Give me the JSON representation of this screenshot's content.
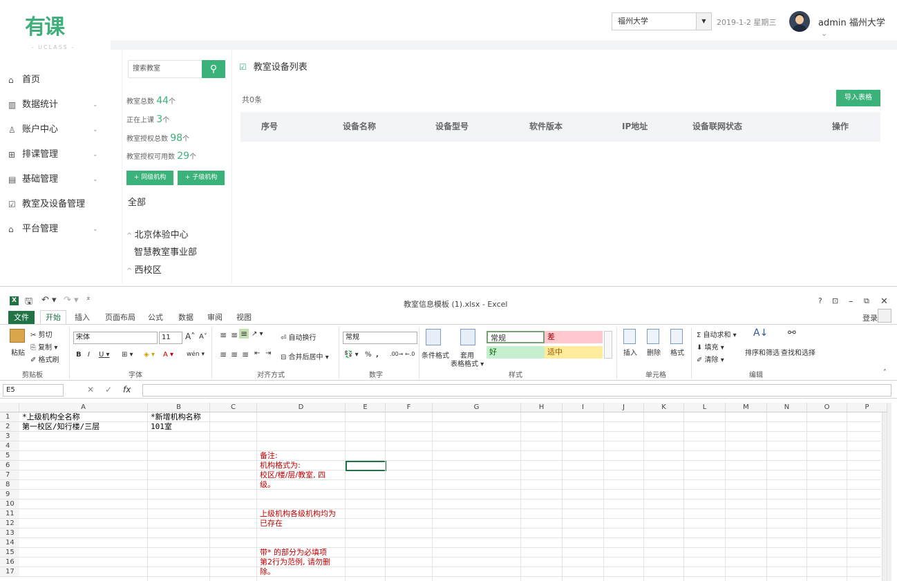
{
  "web": {
    "logo": {
      "mark": "有课",
      "sub": "- UCLASS -"
    },
    "header": {
      "school_select": "福州大学",
      "date": "2019-1-2 星期三",
      "user": "admin 福州大学",
      "user_caret": "⌄"
    },
    "nav": [
      {
        "icon": "⌂",
        "label": "首页",
        "has_chevron": false
      },
      {
        "icon": "▥",
        "label": "数据统计",
        "has_chevron": true
      },
      {
        "icon": "♙",
        "label": "账户中心",
        "has_chevron": true
      },
      {
        "icon": "⊞",
        "label": "排课管理",
        "has_chevron": true
      },
      {
        "icon": "▤",
        "label": "基础管理",
        "has_chevron": true
      },
      {
        "icon": "☑",
        "label": "教室及设备管理",
        "has_chevron": false
      },
      {
        "icon": "⌂",
        "label": "平台管理",
        "has_chevron": true
      }
    ],
    "chevron": "⌄",
    "left_panel": {
      "search_placeholder": "搜索教室",
      "search_icon": "⚲",
      "stats": [
        {
          "label": "教室总数",
          "value": "44",
          "unit": "个"
        },
        {
          "label": "正在上课",
          "value": "3",
          "unit": "个"
        },
        {
          "label": "教室授权总数",
          "value": "98",
          "unit": "个"
        },
        {
          "label": "教室授权可用数",
          "value": "29",
          "unit": "个"
        }
      ],
      "btn_sibling": "+ 同级机构",
      "btn_child": "+ 子级机构",
      "tree_all": "全部",
      "tree": [
        {
          "prefix": "^ ",
          "label": "北京体验中心"
        },
        {
          "prefix": "",
          "label": "智慧教室事业部"
        },
        {
          "prefix": "^ ",
          "label": "西校区"
        }
      ]
    },
    "main": {
      "title_icon": "☑",
      "title": "教室设备列表",
      "count": "共0条",
      "import_btn": "导入表格",
      "columns": [
        "序号",
        "设备名称",
        "设备型号",
        "软件版本",
        "IP地址",
        "设备联网状态",
        "操作"
      ]
    }
  },
  "excel": {
    "app_icon": "X",
    "qa_save": "🖫",
    "qa_undo": "↶ ▾",
    "qa_redo": "↷ ▾",
    "qa_more": "⌅",
    "window_title": "教室信息模板 (1).xlsx - Excel",
    "win_help": "?",
    "win_ribbon_opts": "⊡",
    "win_min": "–",
    "win_restore": "⧉",
    "win_close": "✕",
    "tabs": [
      "文件",
      "开始",
      "插入",
      "页面布局",
      "公式",
      "数据",
      "审阅",
      "视图"
    ],
    "login": "登录",
    "ribbon": {
      "paste": "粘贴",
      "cut": "✂ 剪切",
      "copy": "⎘ 复制 ▾",
      "format_painter": "✐ 格式刷",
      "clipboard": "剪贴板",
      "font_name": "宋体",
      "font_size": "11",
      "grow_font": "A˄",
      "shrink_font": "A˅",
      "bold": "B",
      "italic": "I",
      "underline": "U ▾",
      "border": "⊞ ▾",
      "fill": "◈ ▾",
      "font_color": "A ▾",
      "phonetic": "wén ▾",
      "font_group": "字体",
      "align_top": "≡",
      "align_mid": "≡",
      "align_bottom": "≡",
      "orientation": "↗ ▾",
      "wrap_text": "⏎ 自动换行",
      "align_left": "≡",
      "align_center": "≡",
      "align_right": "≡",
      "indent_dec": "⇤",
      "indent_inc": "⇥",
      "merge_center": "⊟ 合并后居中 ▾",
      "align_group": "对齐方式",
      "number_format": "常规",
      "currency": "💱 ▾",
      "percent": "%",
      "comma": ",",
      "dec_inc": ".00→",
      "dec_dec": "←.0",
      "number_group": "数字",
      "cond_format": "条件格式",
      "table_format_1": "套用",
      "table_format_2": "表格格式 ▾",
      "styles": {
        "normal": "常规",
        "bad": "差",
        "good": "好",
        "neutral": "适中"
      },
      "styles_group": "样式",
      "insert": "插入",
      "delete": "删除",
      "format": "格式",
      "cells_group": "单元格",
      "autosum": "Σ 自动求和 ▾",
      "fill_down": "⬇ 填充 ▾",
      "clear": "✐ 清除 ▾",
      "sort_filter": "排序和筛选",
      "find_select": "查找和选择",
      "edit_group": "编辑",
      "collapse": "˄"
    },
    "name_box": "E5",
    "fx_cancel": "✕",
    "fx_ok": "✓",
    "fx_label": "fx",
    "columns": [
      "A",
      "B",
      "C",
      "D",
      "E",
      "F",
      "G",
      "H",
      "I",
      "J",
      "K",
      "L",
      "M",
      "N",
      "O",
      "P"
    ],
    "rows": [
      "1",
      "2",
      "3",
      "4",
      "5",
      "6",
      "7",
      "8",
      "9",
      "10",
      "11",
      "12",
      "13",
      "14",
      "15",
      "16",
      "17"
    ],
    "cells": {
      "A1": "*上级机构全名称",
      "B1": "*新增机构名称",
      "A2": "第一校区/知行楼/三层",
      "B2": "101室"
    },
    "notes": [
      "备注:",
      "机构格式为:",
      "校区/楼/层/教室, 四",
      "级。",
      "上级机构各级机构均为",
      "已存在",
      "带* 的部分为必填项",
      "第2行为范例, 请勿删",
      "除。"
    ],
    "colors": {
      "excel_green": "#217346",
      "note_red": "#c00000",
      "accent": "#3ab27a"
    }
  }
}
